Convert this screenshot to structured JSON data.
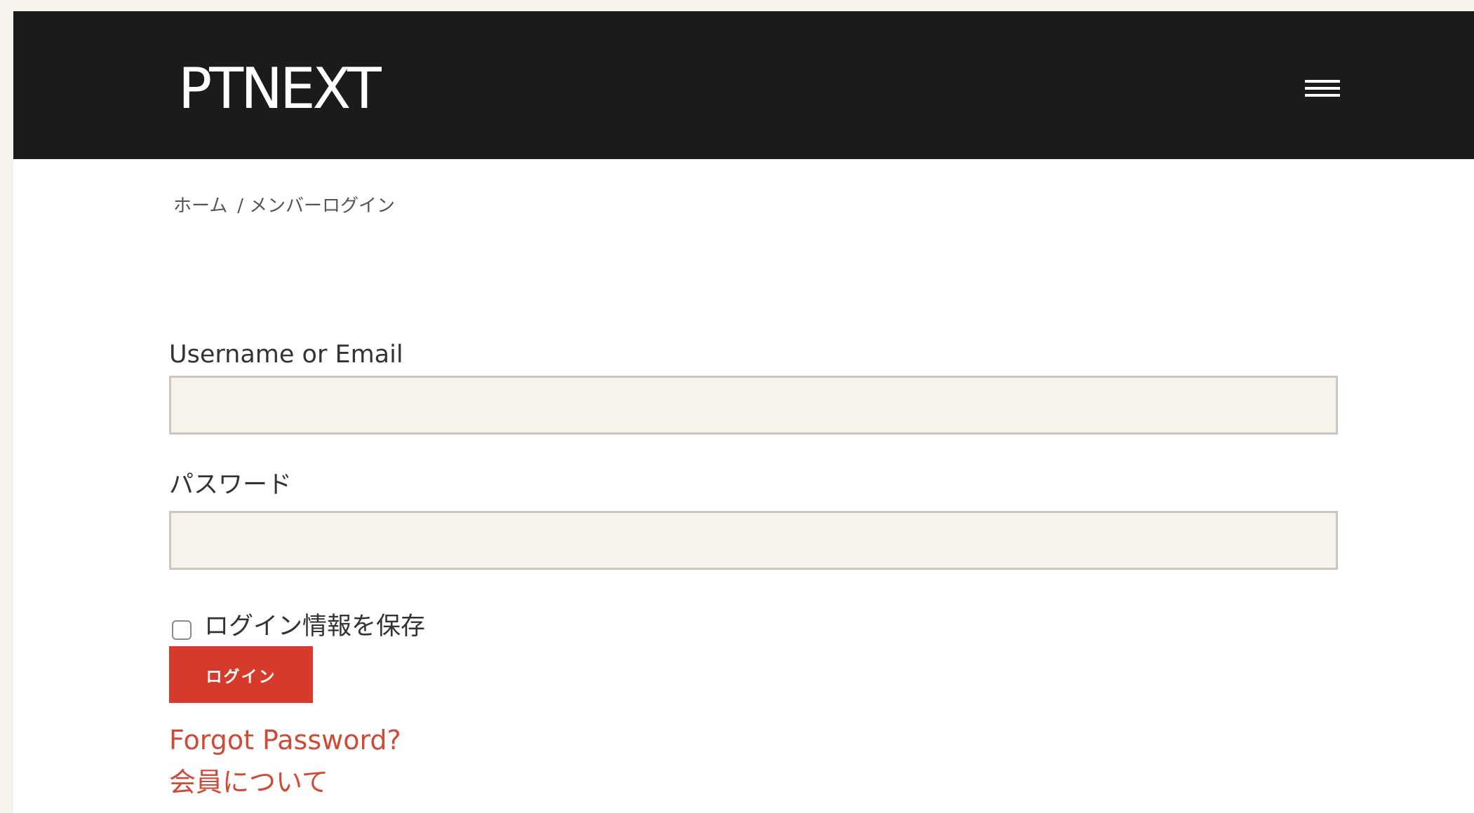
{
  "header": {
    "logo_text": "PTNEXT",
    "menu_icon": "hamburger-menu-icon",
    "background_color": "#1b1b1b"
  },
  "breadcrumb": {
    "home": "ホーム",
    "separator": "/",
    "current": "メンバーログイン"
  },
  "login_form": {
    "username_label": "Username or Email",
    "username_value": "",
    "password_label": "パスワード",
    "password_value": "",
    "remember_label": "ログイン情報を保存",
    "remember_checked": false,
    "submit_label": "ログイン"
  },
  "links": {
    "forgot_password": "Forgot Password?",
    "membership_info": "会員について"
  },
  "colors": {
    "accent": "#d63a2b",
    "link": "#d04a36",
    "input_background": "#f6f2ec",
    "page_background": "#f6f2ec"
  }
}
